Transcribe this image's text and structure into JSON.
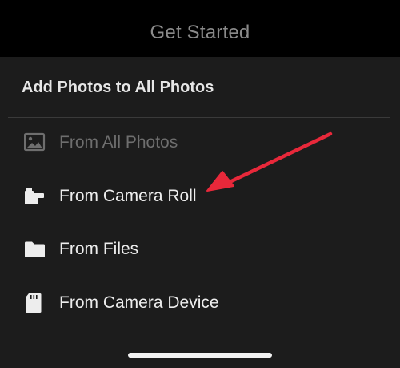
{
  "top_bar": {
    "title": "Get Started"
  },
  "sheet": {
    "header": "Add Photos to All Photos",
    "items": [
      {
        "label": "From All Photos",
        "icon": "image-icon",
        "enabled": false
      },
      {
        "label": "From Camera Roll",
        "icon": "camera-roll-icon",
        "enabled": true
      },
      {
        "label": "From Files",
        "icon": "folder-icon",
        "enabled": true
      },
      {
        "label": "From Camera Device",
        "icon": "sd-card-icon",
        "enabled": true
      }
    ]
  },
  "annotation": {
    "arrow_color": "#e8283a"
  },
  "colors": {
    "text": "#ededed",
    "disabled_text": "#6e6e6e",
    "background": "#1c1c1c"
  }
}
